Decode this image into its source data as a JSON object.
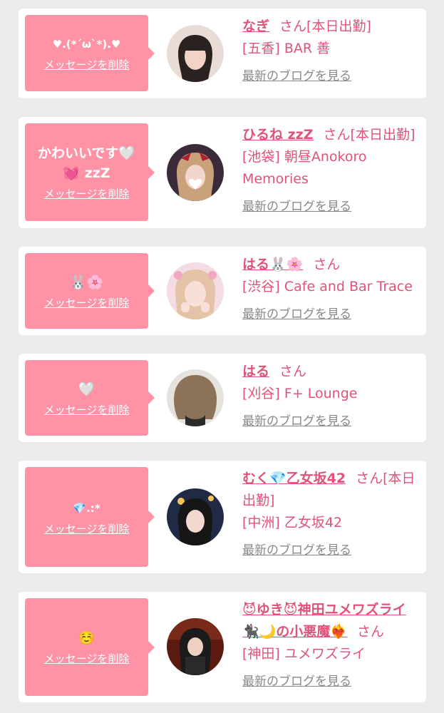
{
  "cards": [
    {
      "message": "♥.(*´ω`*).♥",
      "delete_label": "メッセージを削除",
      "name": "なぎ",
      "san": "さん",
      "status": "[本日出勤]",
      "shop": "[五香] BAR 善",
      "blog_label": "最新のブログを見る"
    },
    {
      "message": "かわいいです🤍💓 zzZ",
      "delete_label": "メッセージを削除",
      "name": "ひるね zzZ",
      "san": "さん",
      "status": "[本日出勤]",
      "shop": "[池袋] 朝昼Anokoro Memories",
      "blog_label": "最新のブログを見る"
    },
    {
      "message": "🐰🌸",
      "delete_label": "メッセージを削除",
      "name": "はる🐰🌸",
      "san": "さん",
      "status": "",
      "shop": "[渋谷] Cafe and Bar Trace",
      "blog_label": "最新のブログを見る"
    },
    {
      "message": "🤍",
      "delete_label": "メッセージを削除",
      "name": "はる",
      "san": "さん",
      "status": "",
      "shop": "[刈谷] F+ Lounge",
      "blog_label": "最新のブログを見る"
    },
    {
      "message": "💎.:*",
      "delete_label": "メッセージを削除",
      "name": "むく💎乙女坂42",
      "san": "さん",
      "status": "[本日出勤]",
      "shop": "[中洲] 乙女坂42",
      "blog_label": "最新のブログを見る"
    },
    {
      "message": "☺️",
      "delete_label": "メッセージを削除",
      "name": "😈ゆき😈神田ユメワズライ🐈‍⬛🌙の小悪魔❤️‍🔥",
      "san": "さん",
      "status": "",
      "shop": "[神田] ユメワズライ",
      "blog_label": "最新のブログを見る"
    }
  ]
}
